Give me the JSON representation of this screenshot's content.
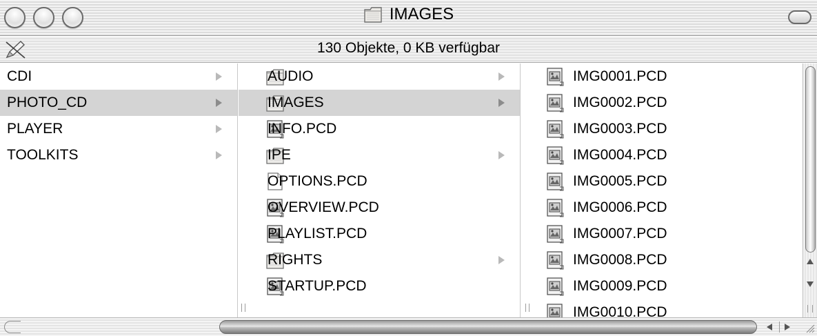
{
  "window": {
    "title": "IMAGES",
    "status": "130 Objekte, 0 KB verfügbar"
  },
  "column1": {
    "items": [
      {
        "label": "CDI",
        "kind": "folder",
        "has_children": true,
        "selected": false
      },
      {
        "label": "PHOTO_CD",
        "kind": "folder",
        "has_children": true,
        "selected": true
      },
      {
        "label": "PLAYER",
        "kind": "folder",
        "has_children": true,
        "selected": false
      },
      {
        "label": "TOOLKITS",
        "kind": "folder",
        "has_children": true,
        "selected": false
      }
    ]
  },
  "column2": {
    "items": [
      {
        "label": "AUDIO",
        "icon": "folder-icon",
        "has_children": true,
        "selected": false
      },
      {
        "label": "IMAGES",
        "icon": "folder-icon",
        "has_children": true,
        "selected": true
      },
      {
        "label": "INFO.PCD",
        "icon": "image-file-icon",
        "has_children": false,
        "selected": false
      },
      {
        "label": "IPE",
        "icon": "folder-icon",
        "has_children": true,
        "selected": false
      },
      {
        "label": "OPTIONS.PCD",
        "icon": "blank-document-icon",
        "has_children": false,
        "selected": false
      },
      {
        "label": "OVERVIEW.PCD",
        "icon": "image-file-icon",
        "has_children": false,
        "selected": false
      },
      {
        "label": "PLAYLIST.PCD",
        "icon": "image-file-icon",
        "has_children": false,
        "selected": false
      },
      {
        "label": "RIGHTS",
        "icon": "folder-icon",
        "has_children": true,
        "selected": false
      },
      {
        "label": "STARTUP.PCD",
        "icon": "image-file-icon",
        "has_children": false,
        "selected": false
      }
    ]
  },
  "column3": {
    "items": [
      {
        "label": "IMG0001.PCD",
        "icon": "image-file-icon"
      },
      {
        "label": "IMG0002.PCD",
        "icon": "image-file-icon"
      },
      {
        "label": "IMG0003.PCD",
        "icon": "image-file-icon"
      },
      {
        "label": "IMG0004.PCD",
        "icon": "image-file-icon"
      },
      {
        "label": "IMG0005.PCD",
        "icon": "image-file-icon"
      },
      {
        "label": "IMG0006.PCD",
        "icon": "image-file-icon"
      },
      {
        "label": "IMG0007.PCD",
        "icon": "image-file-icon"
      },
      {
        "label": "IMG0008.PCD",
        "icon": "image-file-icon"
      },
      {
        "label": "IMG0009.PCD",
        "icon": "image-file-icon"
      },
      {
        "label": "IMG0010.PCD",
        "icon": "image-file-icon"
      }
    ]
  },
  "colors": {
    "selection": "#d4d4d4",
    "disclosure_arrow": "#b9b9b9"
  }
}
